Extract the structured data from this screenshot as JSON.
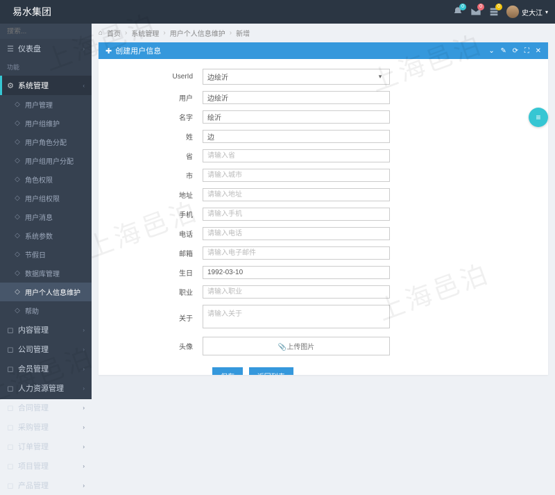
{
  "brand": "易水集团",
  "user": {
    "name": "史大江"
  },
  "badges": [
    {
      "n": "0"
    },
    {
      "n": "0"
    },
    {
      "n": "0"
    }
  ],
  "search_placeholder": "搜索...",
  "sidebar": {
    "dashboard": "仪表盘",
    "function_heading": "功能",
    "items": [
      {
        "label": "系统管理",
        "active": true,
        "top": true,
        "icon": "⚙"
      },
      {
        "label": "用户管理",
        "icon": "◇"
      },
      {
        "label": "用户组维护",
        "icon": "◇"
      },
      {
        "label": "用户角色分配",
        "icon": "◇"
      },
      {
        "label": "用户组用户分配",
        "icon": "◇"
      },
      {
        "label": "角色权限",
        "icon": "◇"
      },
      {
        "label": "用户组权限",
        "icon": "◇"
      },
      {
        "label": "用户消息",
        "icon": "◇"
      },
      {
        "label": "系统参数",
        "icon": "◇"
      },
      {
        "label": "节假日",
        "icon": "◇"
      },
      {
        "label": "数据库管理",
        "icon": "◇"
      },
      {
        "label": "用户个人信息维护",
        "selected": true,
        "icon": "◇"
      },
      {
        "label": "帮助",
        "icon": "◇"
      }
    ],
    "bottom": [
      {
        "label": "内容管理"
      },
      {
        "label": "公司管理"
      },
      {
        "label": "会员管理"
      },
      {
        "label": "人力资源管理"
      },
      {
        "label": "合同管理"
      },
      {
        "label": "采购管理"
      },
      {
        "label": "订单管理"
      },
      {
        "label": "项目管理"
      },
      {
        "label": "产品管理"
      }
    ]
  },
  "breadcrumb": {
    "home": "首页",
    "l1": "系统管理",
    "l2": "用户个人信息维护",
    "l3": "新增"
  },
  "panel": {
    "title": "创建用户信息"
  },
  "form": {
    "userid": {
      "label": "UserId",
      "value": "边绘沂"
    },
    "user": {
      "label": "用户",
      "value": "边绘沂"
    },
    "name": {
      "label": "名字",
      "value": "绘沂"
    },
    "surname": {
      "label": "姓",
      "value": "边"
    },
    "province": {
      "label": "省",
      "placeholder": "请输入省"
    },
    "city": {
      "label": "市",
      "placeholder": "请输入城市"
    },
    "address": {
      "label": "地址",
      "placeholder": "请输入地址"
    },
    "mobile": {
      "label": "手机",
      "placeholder": "请输入手机"
    },
    "phone": {
      "label": "电话",
      "placeholder": "请输入电话"
    },
    "email": {
      "label": "邮箱",
      "placeholder": "请输入电子邮件"
    },
    "birthday": {
      "label": "生日",
      "value": "1992-03-10"
    },
    "occupation": {
      "label": "职业",
      "placeholder": "请输入职业"
    },
    "about": {
      "label": "关于",
      "placeholder": "请输入关于"
    },
    "avatar": {
      "label": "头像",
      "button": "上传图片"
    }
  },
  "buttons": {
    "save": "保存",
    "back": "返回列表"
  },
  "watermark": "上海邑泊"
}
